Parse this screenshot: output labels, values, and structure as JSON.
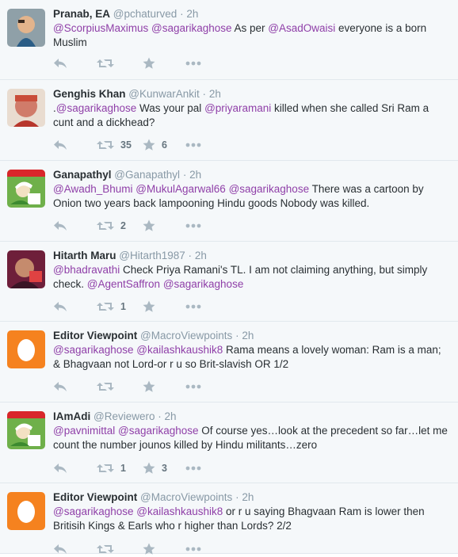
{
  "tweets": [
    {
      "name": "Pranab, EA",
      "handle": "@pchaturved",
      "time": "2h",
      "avatar": "photo-child-avatar",
      "text": [
        {
          "t": "@ScorpiusMaximus",
          "m": true
        },
        {
          "t": " ",
          "m": false
        },
        {
          "t": "@sagarikaghose",
          "m": true
        },
        {
          "t": " As per ",
          "m": false
        },
        {
          "t": "@AsadOwaisi",
          "m": true
        },
        {
          "t": " everyone is a born Muslim",
          "m": false
        }
      ],
      "retweets": "",
      "favorites": ""
    },
    {
      "name": "Genghis Khan",
      "handle": "@KunwarAnkit",
      "time": "2h",
      "avatar": "photo-man-avatar",
      "text": [
        {
          "t": ".",
          "m": false
        },
        {
          "t": "@sagarikaghose",
          "m": true
        },
        {
          "t": " Was your pal ",
          "m": false
        },
        {
          "t": "@priyaramani",
          "m": true
        },
        {
          "t": " killed when she called Sri Ram a cunt and a dickhead?",
          "m": false
        }
      ],
      "retweets": "35",
      "favorites": "6"
    },
    {
      "name": "Ganapathyl",
      "handle": "@Ganapathyl",
      "time": "2h",
      "avatar": "cartoon-avatar",
      "text": [
        {
          "t": "@Awadh_Bhumi",
          "m": true
        },
        {
          "t": " ",
          "m": false
        },
        {
          "t": "@MukulAgarwal66",
          "m": true
        },
        {
          "t": " ",
          "m": false
        },
        {
          "t": "@sagarikaghose",
          "m": true
        },
        {
          "t": " There was a cartoon by Onion two years back lampooning Hindu goods  Nobody was killed.",
          "m": false
        }
      ],
      "retweets": "2",
      "favorites": ""
    },
    {
      "name": "Hitarth Maru",
      "handle": "@Hitarth1987",
      "time": "2h",
      "avatar": "photo-red-avatar",
      "text": [
        {
          "t": "@bhadravathi",
          "m": true
        },
        {
          "t": " Check Priya Ramani's TL. I am not claiming anything, but simply check. ",
          "m": false
        },
        {
          "t": "@AgentSaffron",
          "m": true
        },
        {
          "t": " ",
          "m": false
        },
        {
          "t": "@sagarikaghose",
          "m": true
        }
      ],
      "retweets": "1",
      "favorites": ""
    },
    {
      "name": "Editor Viewpoint",
      "handle": "@MacroViewpoints",
      "time": "2h",
      "avatar": "egg-avatar",
      "text": [
        {
          "t": "@sagarikaghose",
          "m": true
        },
        {
          "t": "  ",
          "m": false
        },
        {
          "t": "@kailashkaushik8",
          "m": true
        },
        {
          "t": " Rama means a lovely woman: Ram is a man; & Bhagvaan not Lord-or r u so Brit-slavish OR 1/2",
          "m": false
        }
      ],
      "retweets": "",
      "favorites": ""
    },
    {
      "name": "IAmAdi",
      "handle": "@Reviewero",
      "time": "2h",
      "avatar": "cartoon-avatar",
      "text": [
        {
          "t": "@pavnimittal",
          "m": true
        },
        {
          "t": " ",
          "m": false
        },
        {
          "t": "@sagarikaghose",
          "m": true
        },
        {
          "t": " Of course yes…look at the precedent so far…let me count the number jounos killed by Hindu militants…zero",
          "m": false
        }
      ],
      "retweets": "1",
      "favorites": "3"
    },
    {
      "name": "Editor Viewpoint",
      "handle": "@MacroViewpoints",
      "time": "2h",
      "avatar": "egg-avatar",
      "text": [
        {
          "t": "@sagarikaghose",
          "m": true
        },
        {
          "t": " ",
          "m": false
        },
        {
          "t": "@kailashkaushik8",
          "m": true
        },
        {
          "t": " or r u saying Bhagvaan Ram is lower then Britisih Kings & Earls who r higher than Lords? 2/2",
          "m": false
        }
      ],
      "retweets": "",
      "favorites": ""
    }
  ],
  "separator": "·",
  "icons": {
    "reply": "reply-icon",
    "retweet": "retweet-icon",
    "favorite": "star-icon",
    "more": "more-icon"
  },
  "colors": {
    "mention": "#8f3fa8",
    "background": "#f5f8fa",
    "muted": "#8899a6",
    "icon": "#aab8c2",
    "egg": "#f5821f"
  }
}
